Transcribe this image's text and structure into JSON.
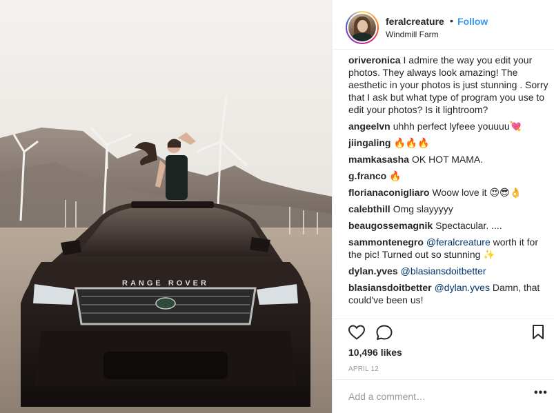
{
  "post": {
    "username": "feralcreature",
    "separator": "•",
    "follow_label": "Follow",
    "location": "Windmill Farm",
    "image_alt": "Woman standing through the sunroof of a black Range Rover in a desert windmill farm",
    "car_badge": "RANGE ROVER"
  },
  "comments": [
    {
      "user": "oriveronica",
      "text": "I admire the way you edit your photos. They always look amazing! The aesthetic in your photos is just stunning . Sorry that I ask but what type of program you use to edit your photos? Is it lightroom?"
    },
    {
      "user": "angeelvn",
      "text": "uhhh perfect lyfeee youuuu💘"
    },
    {
      "user": "jiingaling",
      "text": "🔥🔥🔥"
    },
    {
      "user": "mamkasasha",
      "text": "OK HOT MAMA."
    },
    {
      "user": "g.franco",
      "text": "🔥"
    },
    {
      "user": "florianaconigliaro",
      "text": "Woow love it 😍😎👌"
    },
    {
      "user": "calebthill",
      "text": "Omg slayyyyy"
    },
    {
      "user": "beaugossemagnik",
      "text": "Spectacular. ...."
    },
    {
      "user": "sammontenegro",
      "mention": "@feralcreature",
      "text": " worth it for the pic! Turned out so stunning ✨"
    },
    {
      "user": "dylan.yves",
      "mention": "@blasiansdoitbetter",
      "text": ""
    },
    {
      "user": "blasiansdoitbetter",
      "mention": "@dylan.yves",
      "text": " Damn, that could've been us!"
    }
  ],
  "actions": {
    "likes": "10,496 likes",
    "date": "APRIL 12",
    "like_icon": "heart-outline-icon",
    "comment_icon": "speech-bubble-icon",
    "save_icon": "bookmark-icon"
  },
  "add_comment": {
    "placeholder": "Add a comment…",
    "more_label": "•••"
  },
  "colors": {
    "link_blue": "#3897f0",
    "mention_blue": "#003569",
    "text": "#262626",
    "muted": "#999999",
    "border": "#efefef"
  }
}
